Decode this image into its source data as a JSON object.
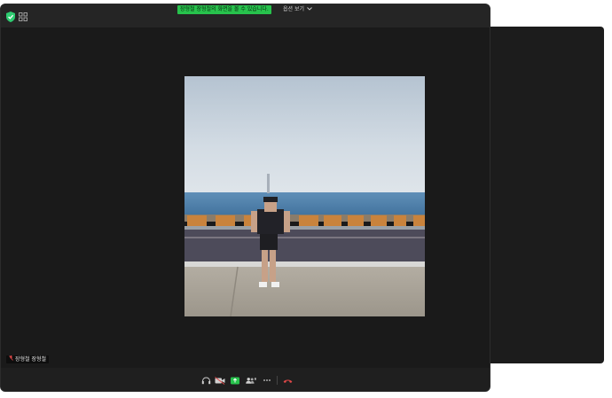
{
  "header": {
    "share_banner": "장형철 장형철의 화면을 볼 수 있습니다.",
    "view_options_label": "옵션 보기"
  },
  "video": {
    "participant_name": "장형철 장형철"
  },
  "icons": {
    "security": "shield-check-icon",
    "gallery": "grid-icon",
    "dropdown": "chevron-down-icon",
    "mic_muted": "mic-muted-icon",
    "audio": "headphones-icon",
    "video": "video-muted-icon",
    "share": "share-screen-icon",
    "participants": "participants-icon",
    "more": "more-icon",
    "leave": "leave-icon"
  },
  "colors": {
    "share_banner_bg": "#27c24c",
    "security_green": "#2ecc71",
    "leave_red": "#e04848",
    "share_green": "#27c24c"
  }
}
